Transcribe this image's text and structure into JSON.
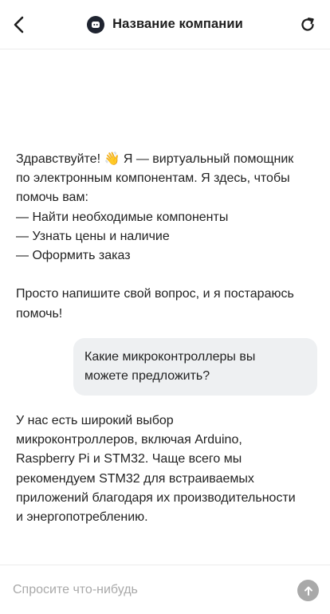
{
  "header": {
    "title": "Название компании",
    "back_icon": "chevron-left-icon",
    "refresh_icon": "refresh-icon",
    "avatar_icon": "bot-icon"
  },
  "messages": {
    "greeting": {
      "line1_text": "Здравствуйте! ",
      "line1_emoji": "👋",
      "line1_rest": " Я — виртуальный помощник",
      "line2": "по электронным компонентам. Я здесь, чтобы",
      "line3": "помочь вам:",
      "bullet1": "— Найти необходимые компоненты",
      "bullet2": "— Узнать цены и наличие",
      "bullet3": "— Оформить заказ",
      "line4": "Просто напишите свой вопрос, и я постараюсь",
      "line5": "помочь!"
    },
    "user": {
      "line1": "Какие микроконтроллеры вы",
      "line2": "можете предложить?"
    },
    "reply": {
      "line1": "У нас есть широкий выбор",
      "line2": "микроконтроллеров, включая Arduino,",
      "line3": "Raspberry Pi и STM32. Чаще всего мы",
      "line4": "рекомендуем STM32 для встраиваемых",
      "line5": "приложений благодаря их производительности",
      "line6": "и энергопотреблению."
    }
  },
  "composer": {
    "placeholder": "Спросите что-нибудь",
    "value": "",
    "send_icon": "arrow-up-icon"
  },
  "colors": {
    "user_bubble": "#eef0f2",
    "send_button": "#a9a9a9",
    "text": "#222222"
  }
}
